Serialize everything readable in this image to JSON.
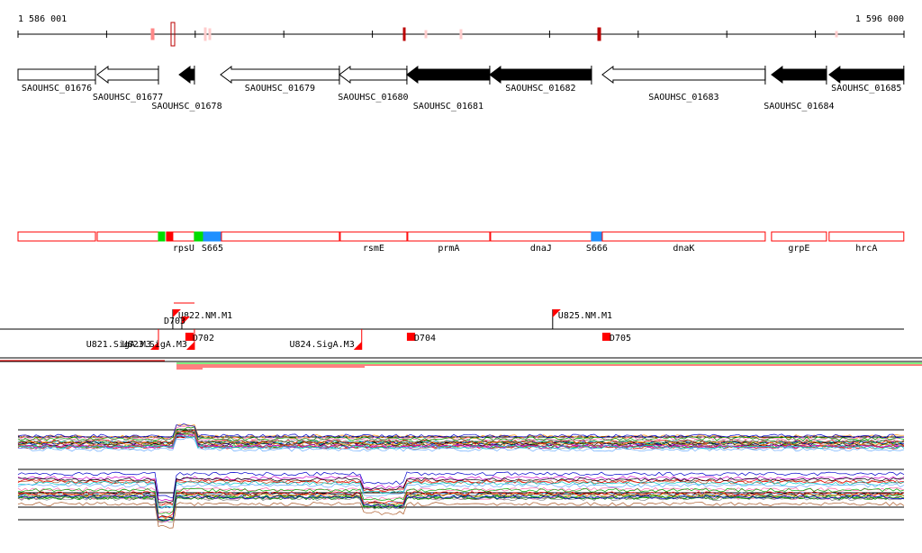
{
  "axis": {
    "start_label": "1 586 001",
    "end_label": "1 596 000",
    "start": 1586001,
    "end": 1596000
  },
  "genes": [
    {
      "name": "SAOUHSC_01676",
      "start": 1586001,
      "end": 1586875,
      "strand": "+",
      "filled": false
    },
    {
      "name": "SAOUHSC_01677",
      "start": 1586895,
      "end": 1587586,
      "strand": "-",
      "filled": false
    },
    {
      "name": "SAOUHSC_01678",
      "start": 1587820,
      "end": 1587992,
      "strand": "-",
      "filled": true
    },
    {
      "name": "SAOUHSC_01679",
      "start": 1588287,
      "end": 1589628,
      "strand": "-",
      "filled": false
    },
    {
      "name": "SAOUHSC_01680",
      "start": 1589628,
      "end": 1590390,
      "strand": "-",
      "filled": false
    },
    {
      "name": "SAOUHSC_01681",
      "start": 1590390,
      "end": 1591325,
      "strand": "-",
      "filled": true
    },
    {
      "name": "SAOUHSC_01682",
      "start": 1591325,
      "end": 1592473,
      "strand": "-",
      "filled": true
    },
    {
      "name": "SAOUHSC_01683",
      "start": 1592595,
      "end": 1594434,
      "strand": "-",
      "filled": false
    },
    {
      "name": "SAOUHSC_01684",
      "start": 1594505,
      "end": 1595125,
      "strand": "-",
      "filled": true
    },
    {
      "name": "SAOUHSC_01685",
      "start": 1595155,
      "end": 1595998,
      "strand": "-",
      "filled": true
    }
  ],
  "regions": [
    {
      "label": "",
      "start": 1586001,
      "end": 1586875,
      "color": "#ffffff"
    },
    {
      "label": "",
      "start": 1586895,
      "end": 1587586,
      "color": "#ffffff"
    },
    {
      "label": "",
      "start": 1587586,
      "end": 1587657,
      "color": "#00dd00"
    },
    {
      "label": "",
      "start": 1587677,
      "end": 1587748,
      "color": "#ff0000"
    },
    {
      "label": "rpsU",
      "start": 1587748,
      "end": 1587992,
      "color": "#ffffff"
    },
    {
      "label": "",
      "start": 1587992,
      "end": 1588094,
      "color": "#00dd00"
    },
    {
      "label": "S665",
      "start": 1588094,
      "end": 1588297,
      "color": "#1e90ff"
    },
    {
      "label": "",
      "start": 1588297,
      "end": 1589628,
      "color": "#ffffff"
    },
    {
      "label": "rsmE",
      "start": 1589638,
      "end": 1590390,
      "color": "#ffffff"
    },
    {
      "label": "prmA",
      "start": 1590400,
      "end": 1591325,
      "color": "#ffffff"
    },
    {
      "label": "dnaJ",
      "start": 1591335,
      "end": 1592473,
      "color": "#ffffff"
    },
    {
      "label": "S666",
      "start": 1592473,
      "end": 1592595,
      "color": "#1e90ff"
    },
    {
      "label": "dnaK",
      "start": 1592595,
      "end": 1594434,
      "color": "#ffffff"
    },
    {
      "label": "grpE",
      "start": 1594505,
      "end": 1595125,
      "color": "#ffffff"
    },
    {
      "label": "hrcA",
      "start": 1595155,
      "end": 1595998,
      "color": "#ffffff"
    }
  ],
  "features": [
    {
      "label": "U822.NM.M1",
      "pos": 1587748,
      "row": "up"
    },
    {
      "label": "D703",
      "pos": 1587850,
      "row": "up2"
    },
    {
      "label": "U825.NM.M1",
      "pos": 1592035,
      "row": "up"
    },
    {
      "label": "D702",
      "pos": 1587890,
      "row": "down"
    },
    {
      "label": "D704",
      "pos": 1590390,
      "row": "down"
    },
    {
      "label": "D705",
      "pos": 1592595,
      "row": "down"
    },
    {
      "label": "U821.SigA.M3",
      "pos": 1587586,
      "row": "down2"
    },
    {
      "label": "U823.SigA.M3",
      "pos": 1587992,
      "row": "down2"
    },
    {
      "label": "U824.SigA.M3",
      "pos": 1589880,
      "row": "down2"
    }
  ],
  "colors": {
    "gene_fill": "#000000",
    "region_outline": "#ff0000",
    "mark": "#ff0000"
  }
}
